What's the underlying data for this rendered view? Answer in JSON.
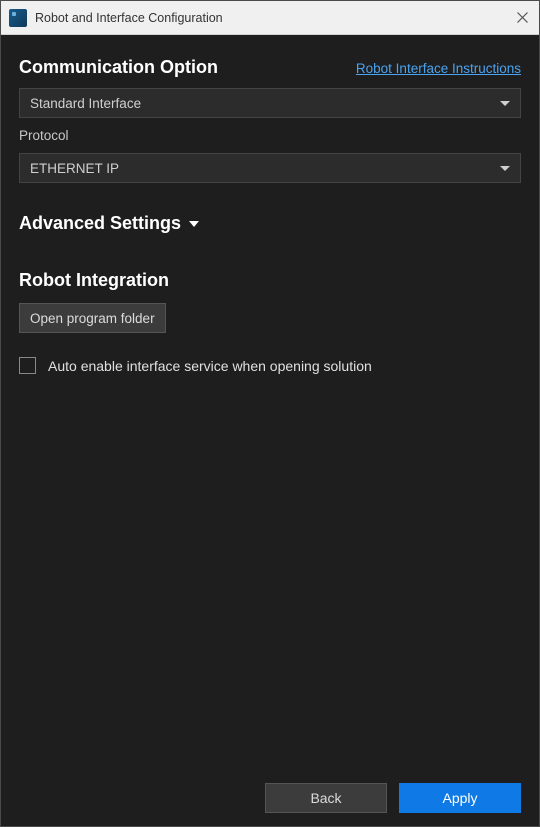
{
  "window": {
    "title": "Robot and Interface Configuration"
  },
  "communication": {
    "title": "Communication Option",
    "instructions_link": "Robot Interface Instructions",
    "interface_selected": "Standard Interface",
    "protocol_label": "Protocol",
    "protocol_selected": "ETHERNET IP"
  },
  "advanced": {
    "title": "Advanced Settings"
  },
  "integration": {
    "title": "Robot Integration",
    "open_folder_label": "Open program folder",
    "auto_enable_label": "Auto enable interface service when opening solution",
    "auto_enable_checked": false
  },
  "footer": {
    "back_label": "Back",
    "apply_label": "Apply"
  }
}
